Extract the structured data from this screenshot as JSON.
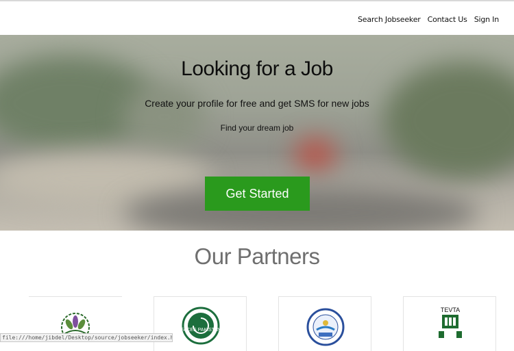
{
  "nav": {
    "items": [
      {
        "label": "Search Jobseeker"
      },
      {
        "label": "Contact Us"
      },
      {
        "label": "Sign In"
      }
    ]
  },
  "hero": {
    "title": "Looking for a Job",
    "subtitle": "Create your profile for free and get SMS for new jobs",
    "tagline": "Find your dream job",
    "cta_label": "Get Started",
    "cta_color": "#2a9a1d"
  },
  "partners": {
    "title": "Our Partners",
    "logos": [
      {
        "icon": "flower-emblem-logo"
      },
      {
        "icon": "faces-pakistan-logo",
        "text": "FACES PAKISTAN"
      },
      {
        "icon": "college-seal-logo"
      },
      {
        "icon": "tevta-logo",
        "text": "TEVTA"
      }
    ]
  },
  "status_bar": {
    "url": "file:///home/jibdel/Desktop/source/jobseeker/index.html#"
  }
}
